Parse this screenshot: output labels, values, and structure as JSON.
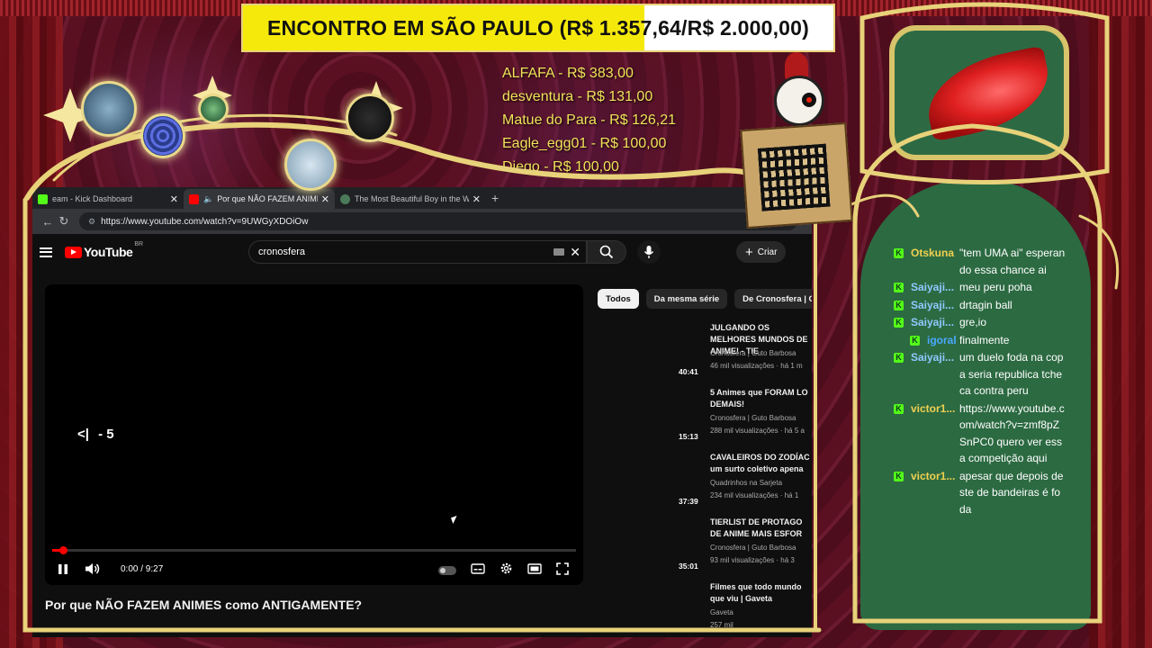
{
  "goal": {
    "label": "ENCONTRO EM SÃO PAULO (R$ 1.357,64/R$ 2.000,00)",
    "progress_fraction": 0.68
  },
  "donors": [
    "ALFAFA - R$ 383,00",
    "desventura - R$ 131,00",
    "Matue do Para - R$ 126,21",
    "Eagle_egg01 - R$ 100,00",
    "Diego - R$ 100,00"
  ],
  "browser": {
    "tabs": [
      {
        "label": "eam - Kick Dashboard",
        "active": false,
        "favicon_color": "#53fc18"
      },
      {
        "label": "Por que NÃO FAZEM ANIMES",
        "active": true,
        "favicon_color": "#ff0000"
      },
      {
        "label": "The Most Beautiful Boy in the W",
        "active": false,
        "favicon_color": "#4a7a5a"
      }
    ],
    "url": "https://www.youtube.com/watch?v=9UWGyXDOiOw"
  },
  "youtube": {
    "logo_text": "YouTube",
    "region": "BR",
    "search_value": "cronosfera",
    "create_label": "Criar",
    "player": {
      "seek_hint": "- 5",
      "time": "0:00 / 9:27",
      "progress_fraction": 0.02
    },
    "video_title": "Por que NÃO FAZEM ANIMES como ANTIGAMENTE?",
    "chips": [
      "Todos",
      "Da mesma série",
      "De Cronosfera | Gu"
    ],
    "recommendations": [
      {
        "title": "JULGANDO OS MELHORES MUNDOS DE ANIME! - TIE",
        "channel": "Cronosfera | Guto Barbosa",
        "meta": "46 mil visualizações · há 1 m",
        "duration": "40:41"
      },
      {
        "title": "5 Animes que FORAM LO DEMAIS!",
        "channel": "Cronosfera | Guto Barbosa",
        "meta": "288 mil visualizações · há 5 a",
        "duration": "15:13"
      },
      {
        "title": "CAVALEIROS DO ZODÍAC um surto coletivo apena",
        "channel": "Quadrinhos na Sarjeta",
        "meta": "234 mil visualizações · há 1",
        "duration": "37:39"
      },
      {
        "title": "TIERLIST DE PROTAGO DE ANIME MAIS ESFOR",
        "channel": "Cronosfera | Guto Barbosa",
        "meta": "93 mil visualizações · há 3",
        "duration": "35:01"
      },
      {
        "title": "Filmes que todo mundo que viu | Gaveta",
        "channel": "Gaveta",
        "meta": "257 mil",
        "duration": ""
      }
    ]
  },
  "chat": {
    "accent": "#53fc18",
    "messages": [
      {
        "user": "Otskuna",
        "color": "#f0d050",
        "text": "\"tem UMA ai\" esperando essa chance ai",
        "indent": false
      },
      {
        "user": "Saiyaji...",
        "color": "#8fc8ff",
        "text": "meu peru poha",
        "indent": false
      },
      {
        "user": "Saiyaji...",
        "color": "#8fc8ff",
        "text": "drtagin ball",
        "indent": false
      },
      {
        "user": "Saiyaji...",
        "color": "#8fc8ff",
        "text": "gre,io",
        "indent": false
      },
      {
        "user": "igoral",
        "color": "#4aa8ff",
        "text": "finalmente",
        "indent": true
      },
      {
        "user": "Saiyaji...",
        "color": "#8fc8ff",
        "text": "um duelo foda na copa seria republica tcheca contra peru",
        "indent": false
      },
      {
        "user": "victor1...",
        "color": "#f0d050",
        "text": "https://www.youtube.com/watch?v=zmf8pZSnPC0 quero ver essa competição aqui",
        "indent": false
      },
      {
        "user": "victor1...",
        "color": "#f0d050",
        "text": "apesar que depois deste de bandeiras é foda",
        "indent": false
      }
    ]
  }
}
